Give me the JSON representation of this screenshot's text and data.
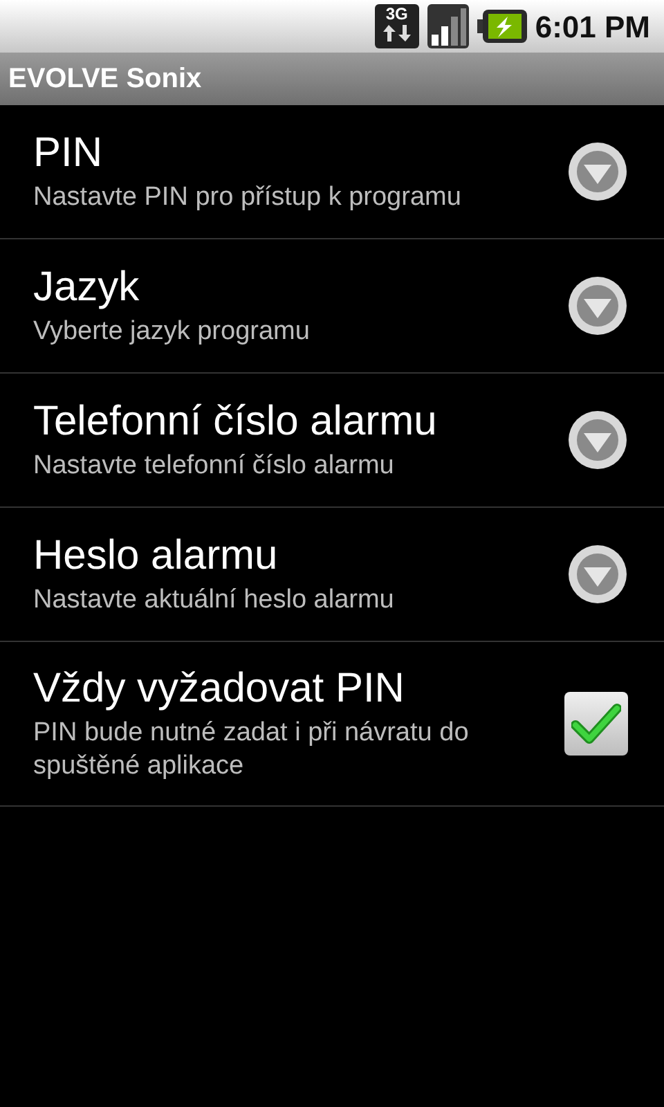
{
  "status_bar": {
    "network": "3G",
    "time": "6:01 PM"
  },
  "title_bar": {
    "title": "EVOLVE Sonix"
  },
  "preferences": [
    {
      "kind": "dialog",
      "title": "PIN",
      "summary": "Nastavte PIN pro přístup k programu"
    },
    {
      "kind": "dialog",
      "title": "Jazyk",
      "summary": "Vyberte jazyk programu"
    },
    {
      "kind": "dialog",
      "title": "Telefonní číslo alarmu",
      "summary": "Nastavte telefonní číslo alarmu"
    },
    {
      "kind": "dialog",
      "title": "Heslo alarmu",
      "summary": "Nastavte aktuální heslo alarmu"
    },
    {
      "kind": "checkbox",
      "title": "Vždy vyžadovat PIN",
      "summary": "PIN bude nutné zadat i při návratu do spuštěné aplikace",
      "checked": true
    }
  ]
}
